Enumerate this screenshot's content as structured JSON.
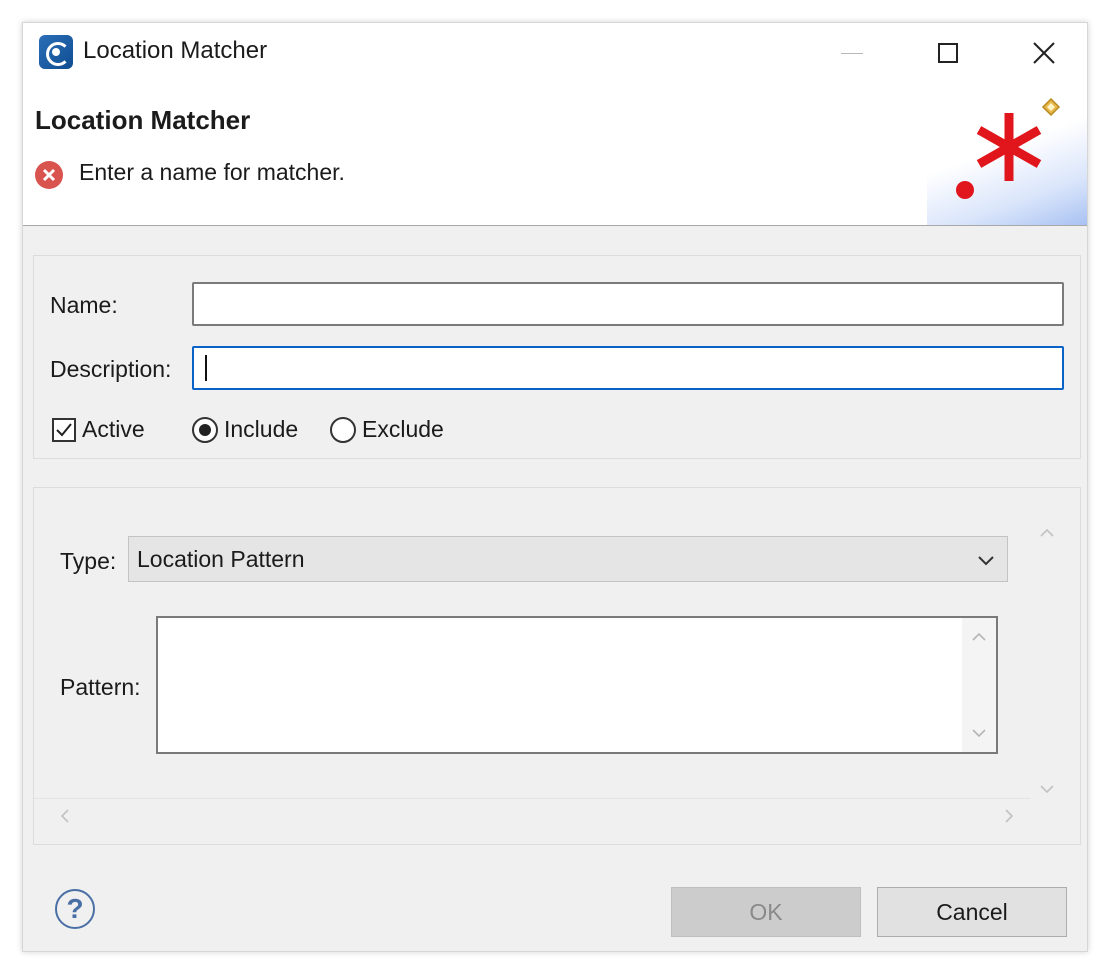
{
  "window": {
    "title": "Location Matcher"
  },
  "banner": {
    "title": "Location Matcher",
    "message": "Enter a name for matcher."
  },
  "form": {
    "name_label": "Name:",
    "name_value": "",
    "description_label": "Description:",
    "description_value": "",
    "active_label": "Active",
    "active_checked": true,
    "include_label": "Include",
    "exclude_label": "Exclude",
    "mode_selected": "Include"
  },
  "matcher": {
    "type_label": "Type:",
    "type_value": "Location Pattern",
    "pattern_label": "Pattern:",
    "pattern_value": ""
  },
  "buttons": {
    "ok_label": "OK",
    "cancel_label": "Cancel",
    "help_symbol": "?"
  },
  "icons": {
    "app": "app-logo-icon",
    "error": "error-icon",
    "banner": "wizard-asterisk-icon",
    "help": "help-icon"
  },
  "colors": {
    "error": "#d9534f",
    "focus_border": "#0a64c8",
    "banner_asterisk": "#e0161c"
  }
}
